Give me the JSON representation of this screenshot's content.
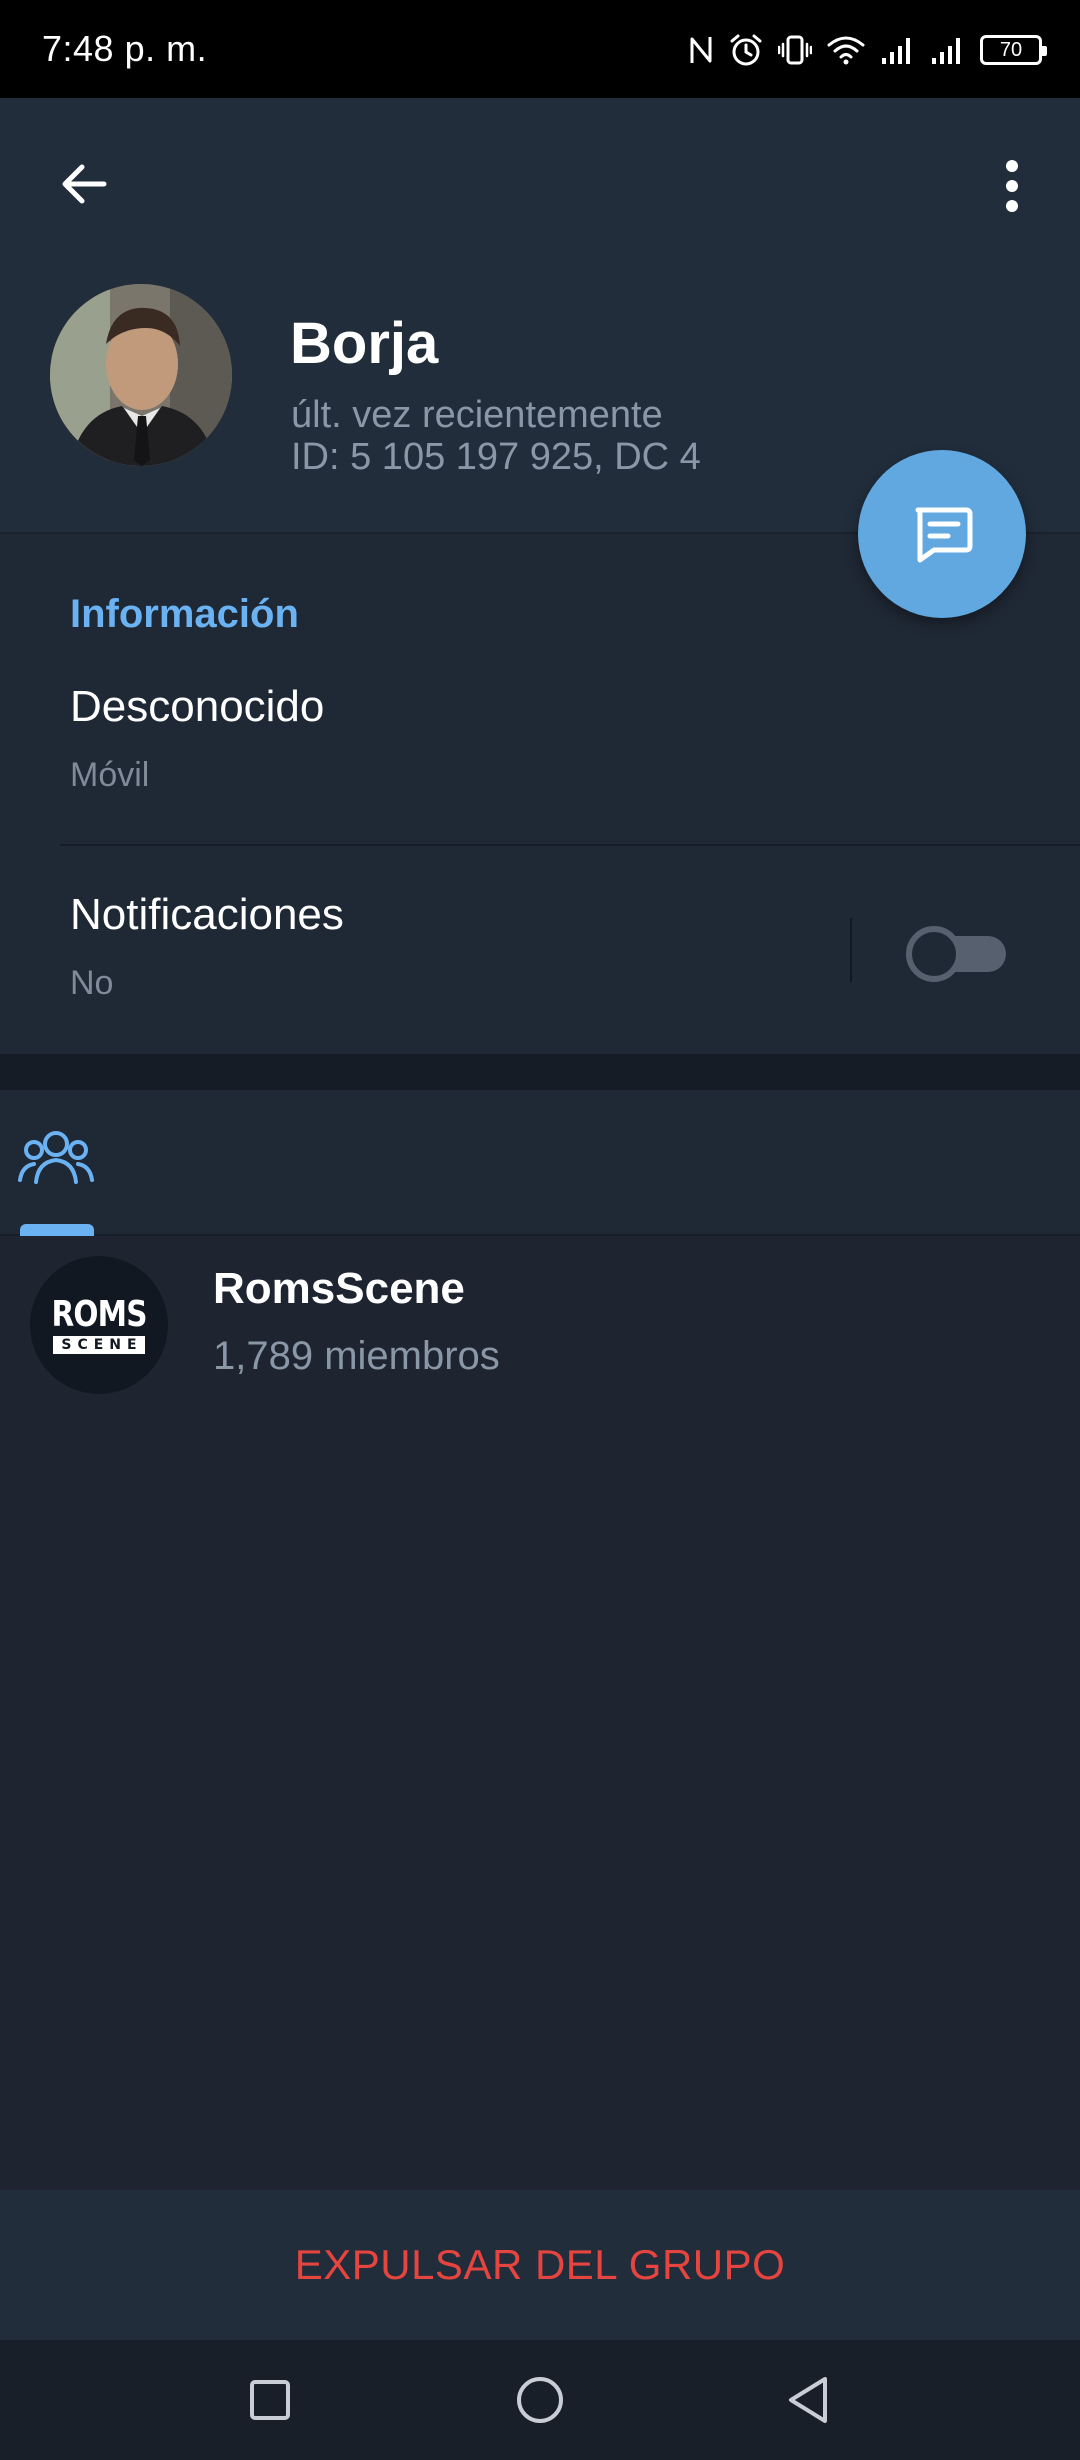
{
  "status_bar": {
    "time": "7:48 p. m.",
    "battery": "70",
    "icons": [
      "nfc-icon",
      "alarm-icon",
      "vibrate-icon",
      "wifi-icon",
      "signal-icon",
      "signal-icon",
      "battery-icon"
    ]
  },
  "header": {
    "back_icon": "arrow-left-icon",
    "menu_icon": "more-vertical-icon",
    "name": "Borja",
    "status": "últ. vez recientemente",
    "id_line": "ID: 5 105 197 925, DC 4",
    "fab_icon": "message-icon"
  },
  "info": {
    "title": "Información",
    "phone_value": "Desconocido",
    "phone_label": "Móvil",
    "notifications_label": "Notificaciones",
    "notifications_value": "No",
    "notifications_enabled": false
  },
  "tabs": [
    {
      "icon": "groups-icon",
      "selected": true
    }
  ],
  "groups": [
    {
      "name": "RomsScene",
      "members": "1,789 miembros",
      "logo_top": "ROMS",
      "logo_bottom": "SCENE"
    }
  ],
  "actions": {
    "kick": "EXPULSAR DEL GRUPO"
  },
  "nav": [
    "recents-icon",
    "home-icon",
    "back-icon"
  ],
  "colors": {
    "accent": "#6ab2f2",
    "fab": "#62a8e0",
    "danger": "#e5443f",
    "background": "#1e2530",
    "header": "#212d3b"
  }
}
